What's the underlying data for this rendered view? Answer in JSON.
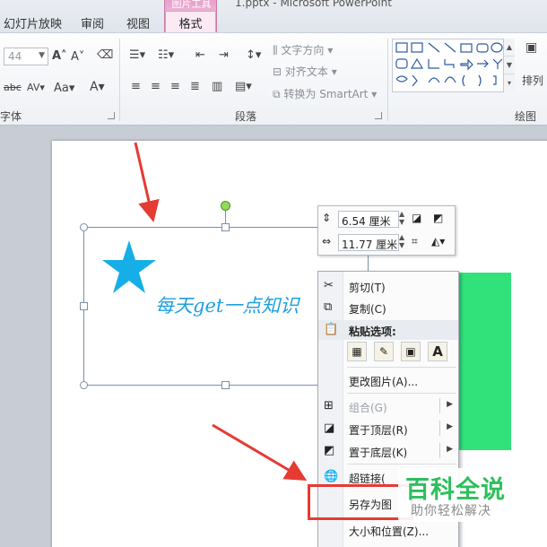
{
  "title_bar": {
    "contextual_group": "图片工具",
    "document_title": "1.pptx - Microsoft PowerPoint"
  },
  "tabs": {
    "slideshow": "幻灯片放映",
    "review": "审阅",
    "view": "视图",
    "format": "格式"
  },
  "ribbon": {
    "font": {
      "size_value": "44",
      "group_label": "字体"
    },
    "paragraph": {
      "text_direction": "文字方向",
      "align_text": "对齐文本",
      "convert_smartart": "转换为 SmartArt",
      "group_label": "段落"
    },
    "drawing": {
      "arrange": "排列",
      "group_label": "绘图"
    }
  },
  "slide": {
    "picture_text": "每天get一点知识",
    "star_color": "#16aee6",
    "green_rect_color": "#31e27b"
  },
  "mini_toolbar": {
    "height": "6.54 厘米",
    "width": "11.77 厘米"
  },
  "context_menu": {
    "items": [
      {
        "label": "剪切(T)",
        "icon": "scissors-icon"
      },
      {
        "label": "复制(C)",
        "icon": "copy-icon"
      },
      {
        "label": "粘贴选项:",
        "icon": "paste-icon"
      },
      {
        "label": "更改图片(A)...",
        "icon": ""
      },
      {
        "label": "组合(G)",
        "icon": "group-icon"
      },
      {
        "label": "置于顶层(R)",
        "icon": "bring-front-icon"
      },
      {
        "label": "置于底层(K)",
        "icon": "send-back-icon"
      },
      {
        "label": "超链接(",
        "icon": "hyperlink-icon"
      },
      {
        "label": "另存为图",
        "icon": ""
      },
      {
        "label": "大小和位置(Z)...",
        "icon": ""
      }
    ]
  },
  "watermark": {
    "main": "百科全说",
    "sub": "助你轻松解决"
  },
  "accent_colors": {
    "annotation_red": "#e53b33",
    "format_tab": "#e7a0cb"
  }
}
